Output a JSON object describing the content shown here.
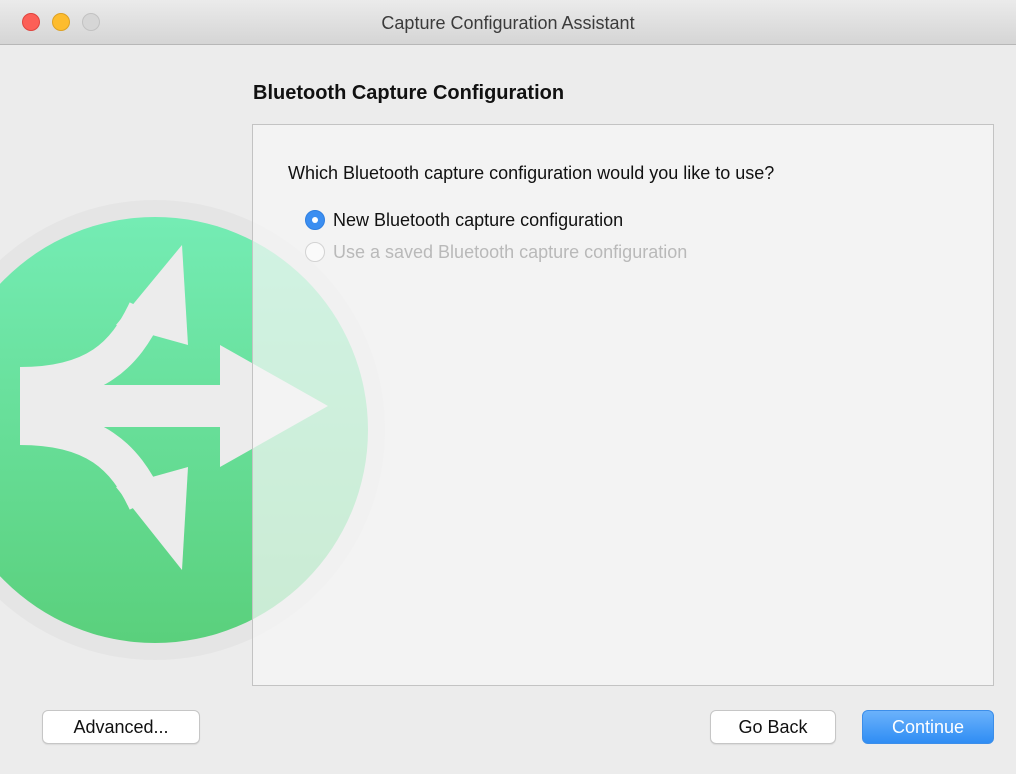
{
  "window": {
    "title": "Capture Configuration Assistant"
  },
  "colors": {
    "accent": "#3b8ef1",
    "continue_button": "#2f8df4",
    "watermark_green": "#62dc92",
    "close": "#fc5f57",
    "minimize": "#fdbc2e"
  },
  "icons": {
    "watermark": "branching-arrows-icon"
  },
  "main": {
    "section_heading": "Bluetooth Capture Configuration",
    "question": "Which Bluetooth capture configuration would you like to use?",
    "options": [
      {
        "label": "New Bluetooth capture configuration",
        "selected": true,
        "enabled": true
      },
      {
        "label": "Use a saved Bluetooth capture configuration",
        "selected": false,
        "enabled": false
      }
    ]
  },
  "footer": {
    "advanced_label": "Advanced...",
    "back_label": "Go Back",
    "continue_label": "Continue"
  }
}
